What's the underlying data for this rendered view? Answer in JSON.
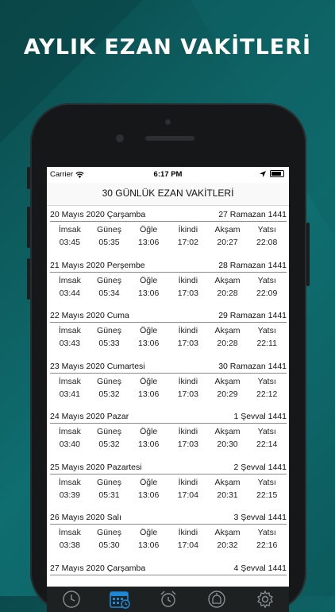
{
  "promo_title": "AYLIK EZAN VAKİTLERİ",
  "status": {
    "carrier": "Carrier",
    "time": "6:17 PM"
  },
  "nav_title": "30 GÜNLÜK EZAN VAKİTLERİ",
  "prayer_labels": [
    "İmsak",
    "Güneş",
    "Öğle",
    "İkindi",
    "Akşam",
    "Yatsı"
  ],
  "days": [
    {
      "date": "20 Mayıs 2020 Çarşamba",
      "hijri": "27 Ramazan 1441",
      "times": [
        "03:45",
        "05:35",
        "13:06",
        "17:02",
        "20:27",
        "22:08"
      ]
    },
    {
      "date": "21 Mayıs 2020 Perşembe",
      "hijri": "28 Ramazan 1441",
      "times": [
        "03:44",
        "05:34",
        "13:06",
        "17:03",
        "20:28",
        "22:09"
      ]
    },
    {
      "date": "22 Mayıs 2020 Cuma",
      "hijri": "29 Ramazan 1441",
      "times": [
        "03:43",
        "05:33",
        "13:06",
        "17:03",
        "20:28",
        "22:11"
      ]
    },
    {
      "date": "23 Mayıs 2020 Cumartesi",
      "hijri": "30 Ramazan 1441",
      "times": [
        "03:41",
        "05:32",
        "13:06",
        "17:03",
        "20:29",
        "22:12"
      ]
    },
    {
      "date": "24 Mayıs 2020 Pazar",
      "hijri": "1 Şevval 1441",
      "times": [
        "03:40",
        "05:32",
        "13:06",
        "17:03",
        "20:30",
        "22:14"
      ]
    },
    {
      "date": "25 Mayıs 2020 Pazartesi",
      "hijri": "2 Şevval 1441",
      "times": [
        "03:39",
        "05:31",
        "13:06",
        "17:04",
        "20:31",
        "22:15"
      ]
    },
    {
      "date": "26 Mayıs 2020 Salı",
      "hijri": "3 Şevval 1441",
      "times": [
        "03:38",
        "05:30",
        "13:06",
        "17:04",
        "20:32",
        "22:16"
      ]
    },
    {
      "date": "27 Mayıs 2020 Çarşamba",
      "hijri": "4 Şevval 1441",
      "times": []
    }
  ],
  "tabs": [
    {
      "icon": "clock-icon",
      "selected": false
    },
    {
      "icon": "calendar-icon",
      "selected": true
    },
    {
      "icon": "alarm-icon",
      "selected": false
    },
    {
      "icon": "mosque-icon",
      "selected": false
    },
    {
      "icon": "gear-icon",
      "selected": false
    }
  ],
  "colors": {
    "background": "#0f6e70",
    "accent": "#1e88d8",
    "tabbar": "#1e2122"
  }
}
